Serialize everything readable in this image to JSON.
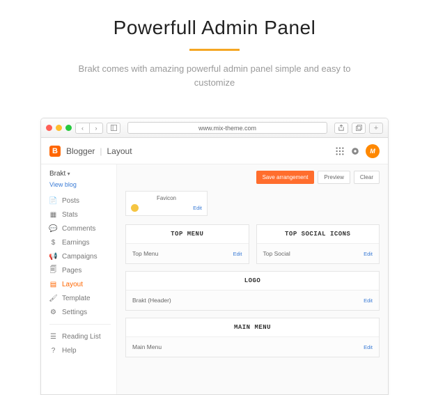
{
  "hero": {
    "title": "Powerfull Admin Panel",
    "subtitle": "Brakt comes with amazing powerful admin panel simple and easy to customize"
  },
  "browser": {
    "url": "www.mix-theme.com"
  },
  "header": {
    "brand": "Blogger",
    "section": "Layout",
    "avatar": "M"
  },
  "sidebar": {
    "blog": "Brakt",
    "view_blog": "View blog",
    "items": [
      {
        "label": "Posts"
      },
      {
        "label": "Stats"
      },
      {
        "label": "Comments"
      },
      {
        "label": "Earnings"
      },
      {
        "label": "Campaigns"
      },
      {
        "label": "Pages"
      },
      {
        "label": "Layout"
      },
      {
        "label": "Template"
      },
      {
        "label": "Settings"
      }
    ],
    "lower": [
      {
        "label": "Reading List"
      },
      {
        "label": "Help"
      }
    ]
  },
  "toolbar": {
    "save": "Save arrangement",
    "preview": "Preview",
    "clear": "Clear"
  },
  "layout": {
    "favicon": {
      "title": "Favicon",
      "edit": "Edit"
    },
    "top_menu": {
      "head": "TOP MENU",
      "gadget": "Top Menu",
      "edit": "Edit"
    },
    "top_social": {
      "head": "TOP SOCIAL ICONS",
      "gadget": "Top Social",
      "edit": "Edit"
    },
    "logo": {
      "head": "LOGO",
      "gadget": "Brakt (Header)",
      "edit": "Edit"
    },
    "main_menu": {
      "head": "MAIN MENU",
      "gadget": "Main Menu",
      "edit": "Edit"
    }
  }
}
